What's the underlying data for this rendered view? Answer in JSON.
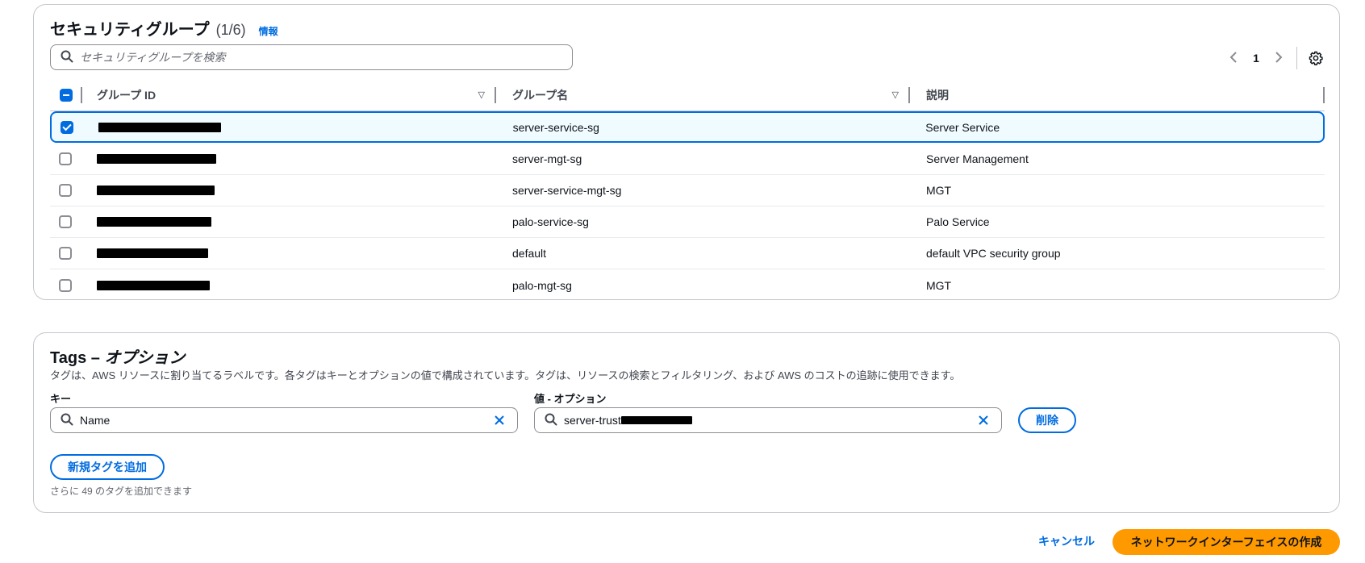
{
  "security_groups": {
    "title": "セキュリティグループ",
    "count": "(1/6)",
    "info_link": "情報",
    "search_placeholder": "セキュリティグループを検索",
    "page": "1",
    "columns": {
      "group_id": "グループ ID",
      "group_name": "グループ名",
      "description": "説明"
    },
    "rows": [
      {
        "name": "server-service-sg",
        "description": "Server Service",
        "checked": true
      },
      {
        "name": "server-mgt-sg",
        "description": "Server Management",
        "checked": false
      },
      {
        "name": "server-service-mgt-sg",
        "description": "MGT",
        "checked": false
      },
      {
        "name": "palo-service-sg",
        "description": "Palo Service",
        "checked": false
      },
      {
        "name": "default",
        "description": "default VPC security group",
        "checked": false
      },
      {
        "name": "palo-mgt-sg",
        "description": "MGT",
        "checked": false
      }
    ]
  },
  "tags": {
    "title_prefix": "Tags –",
    "title_suffix": "オプション",
    "description": "タグは、AWS リソースに割り当てるラベルです。各タグはキーとオプションの値で構成されています。タグは、リソースの検索とフィルタリング、および AWS のコストの追跡に使用できます。",
    "key_label": "キー",
    "value_label": "値 - オプション",
    "key_value": "Name",
    "value_value": "server-trust",
    "remove_label": "削除",
    "add_label": "新規タグを追加",
    "hint": "さらに 49 のタグを追加できます"
  },
  "footer": {
    "cancel_label": "キャンセル",
    "create_label": "ネットワークインターフェイスの作成"
  },
  "colors": {
    "accent": "#006ce0",
    "primary_button": "#ff9900",
    "border": "#c6c6cd"
  }
}
